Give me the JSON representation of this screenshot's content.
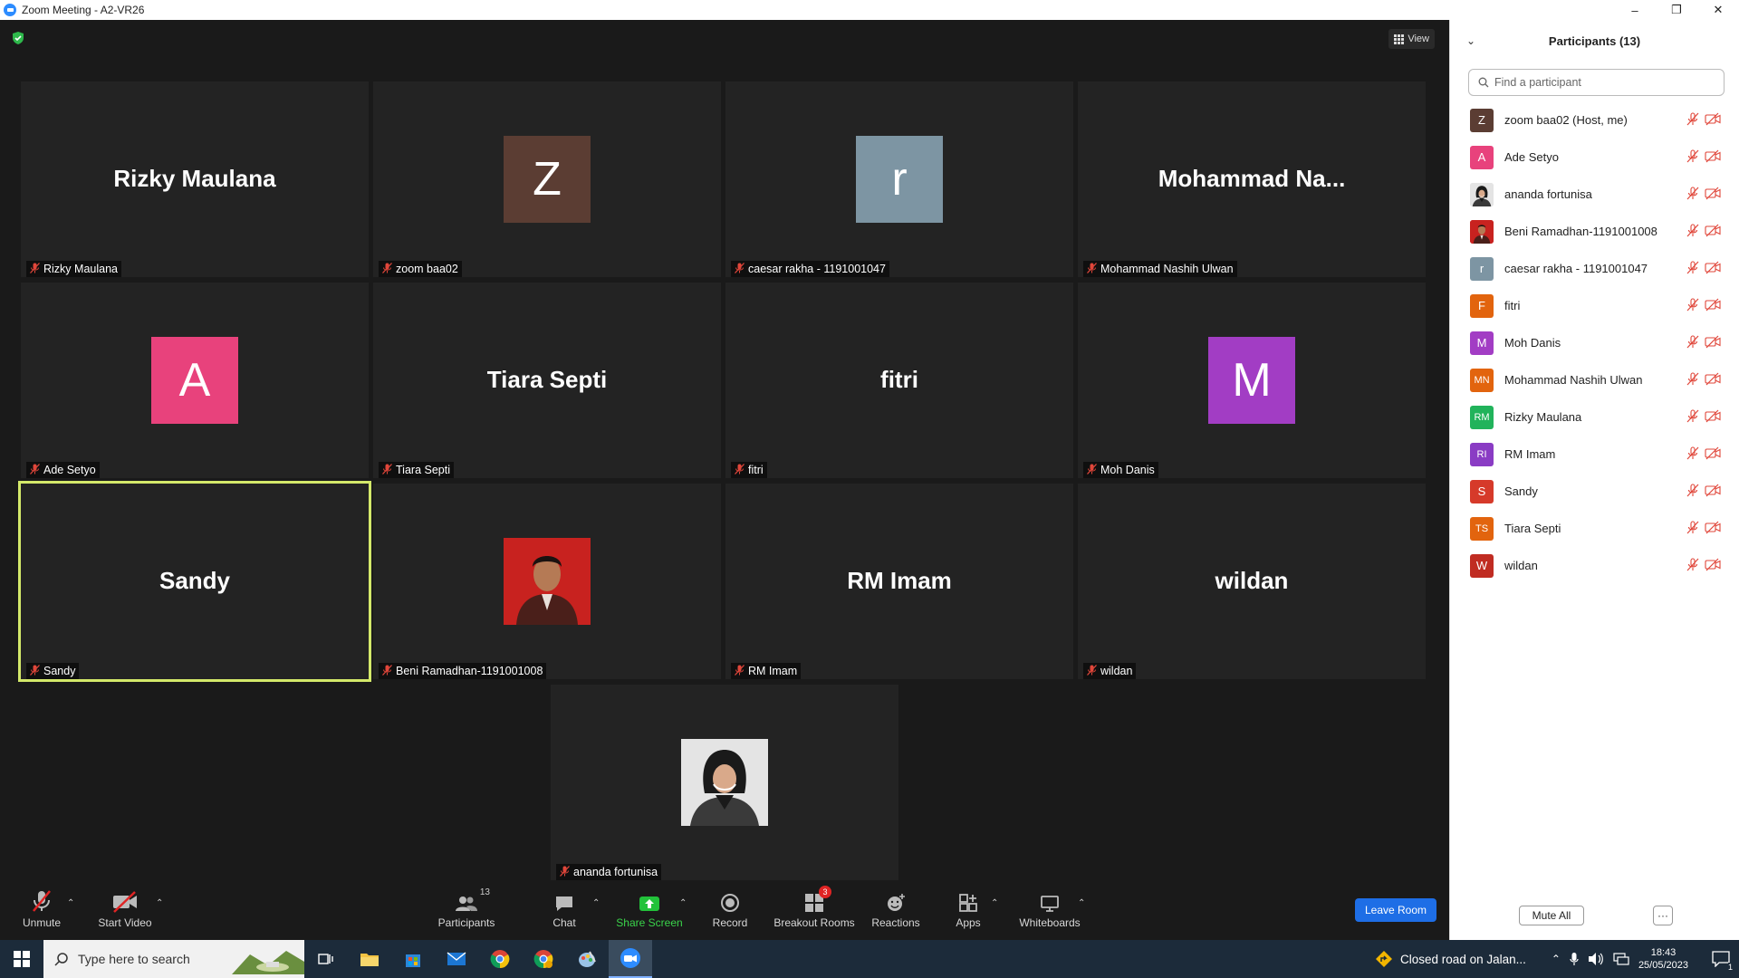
{
  "window": {
    "title": "Zoom Meeting - A2-VR26",
    "minimize": "–",
    "restore": "❐",
    "close": "✕"
  },
  "meeting": {
    "view_label": "View",
    "tiles": [
      {
        "display": "Rizky Maulana",
        "type": "name",
        "label": "Rizky Maulana"
      },
      {
        "display": "Z",
        "type": "avatar",
        "color": "#5b3d33",
        "label": "zoom baa02"
      },
      {
        "display": "r",
        "type": "avatar",
        "color": "#7d95a3",
        "label": "caesar rakha - 1191001047"
      },
      {
        "display": "Mohammad  Na...",
        "type": "name",
        "label": "Mohammad Nashih Ulwan"
      },
      {
        "display": "A",
        "type": "avatar",
        "color": "#e8427c",
        "label": "Ade Setyo"
      },
      {
        "display": "Tiara Septi",
        "type": "name",
        "label": "Tiara Septi"
      },
      {
        "display": "fitri",
        "type": "name",
        "label": "fitri"
      },
      {
        "display": "M",
        "type": "avatar",
        "color": "#a23dc4",
        "label": "Moh Danis"
      },
      {
        "display": "Sandy",
        "type": "name",
        "label": "Sandy",
        "active": true
      },
      {
        "display": "",
        "type": "photo-red",
        "label": "Beni Ramadhan-1191001008"
      },
      {
        "display": "RM Imam",
        "type": "name",
        "label": "RM Imam"
      },
      {
        "display": "wildan",
        "type": "name",
        "label": "wildan"
      },
      {
        "display": "",
        "type": "photo-white",
        "label": "ananda fortunisa"
      }
    ]
  },
  "toolbar": {
    "unmute": "Unmute",
    "start_video": "Start Video",
    "participants": "Participants",
    "participants_count": "13",
    "chat": "Chat",
    "share_screen": "Share Screen",
    "record": "Record",
    "breakout_rooms": "Breakout Rooms",
    "breakout_badge": "3",
    "reactions": "Reactions",
    "apps": "Apps",
    "whiteboards": "Whiteboards",
    "leave": "Leave Room"
  },
  "panel": {
    "title": "Participants (13)",
    "search_placeholder": "Find a participant",
    "participants": [
      {
        "name": "zoom baa02 (Host, me)",
        "initials": "Z",
        "color": "#5b3d33"
      },
      {
        "name": "Ade Setyo",
        "initials": "A",
        "color": "#e8427c"
      },
      {
        "name": "ananda fortunisa",
        "initials": "",
        "color": "#dddddd",
        "photo": "hijab"
      },
      {
        "name": "Beni Ramadhan-1191001008",
        "initials": "",
        "color": "#c92020",
        "photo": "red"
      },
      {
        "name": "caesar rakha - 1191001047",
        "initials": "r",
        "color": "#7d95a3"
      },
      {
        "name": "fitri",
        "initials": "F",
        "color": "#e2640e"
      },
      {
        "name": "Moh Danis",
        "initials": "M",
        "color": "#a23dc4"
      },
      {
        "name": "Mohammad Nashih Ulwan",
        "initials": "MN",
        "color": "#e2640e"
      },
      {
        "name": "Rizky Maulana",
        "initials": "RM",
        "color": "#21b35b"
      },
      {
        "name": "RM Imam",
        "initials": "RI",
        "color": "#8a3cc4"
      },
      {
        "name": "Sandy",
        "initials": "S",
        "color": "#d63a2a"
      },
      {
        "name": "Tiara Septi",
        "initials": "TS",
        "color": "#e2640e"
      },
      {
        "name": "wildan",
        "initials": "W",
        "color": "#c02c22"
      }
    ],
    "mute_all": "Mute All",
    "more": "···"
  },
  "taskbar": {
    "search_placeholder": "Type here to search",
    "news": "Closed road on Jalan...",
    "time": "18:43",
    "date": "25/05/2023",
    "notif_count": "1"
  }
}
